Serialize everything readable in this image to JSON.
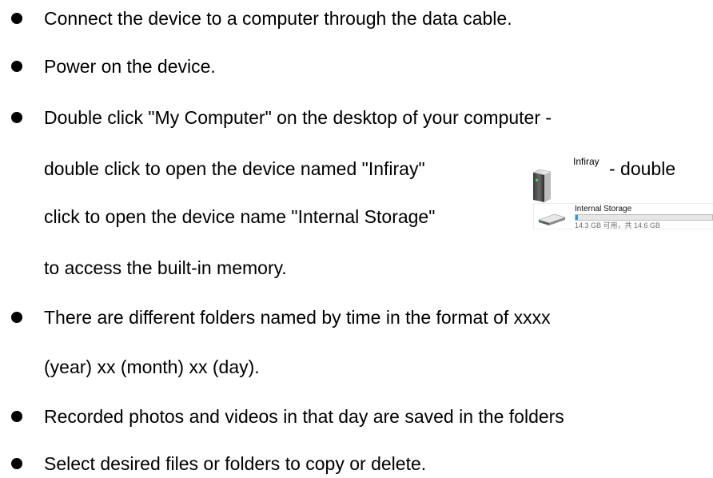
{
  "instructions": {
    "step1": "Connect the device to a computer through the data cable.",
    "step2": "Power on the device.",
    "step3_line1": "Double click \"My Computer\" on the desktop of your computer -",
    "step3_line2_before": "double click to open the device named \"Infiray\"",
    "step3_line2_after": "- double",
    "step3_line3": "click to open the device name \"Internal Storage\"",
    "step3_line4": "to access the built-in memory.",
    "step4_line1": "There are different folders named by time in the format of xxxx",
    "step4_line2": "(year) xx (month) xx (day).",
    "step5": "Recorded photos and videos in that day are saved in the folders",
    "step6": "Select desired files or folders to copy or delete."
  },
  "infiray_drive": {
    "label": "Infiray",
    "icon": "removable-drive-icon"
  },
  "internal_storage": {
    "name": "Internal Storage",
    "free_text": "14.3 GB 可用，共 14.6 GB",
    "used_fraction": 0.02,
    "bar_color": "#26a0da",
    "icon": "hard-drive-icon"
  }
}
